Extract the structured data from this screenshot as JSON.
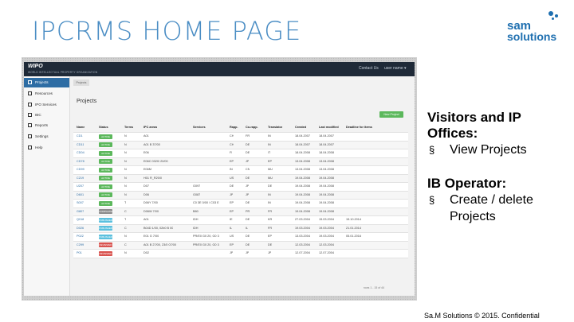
{
  "slide": {
    "title": "IPCRMS HOME PAGE",
    "logo_line1": "sam",
    "logo_line2": "solutions",
    "footer": "Sa.M Solutions © 2015. Confidential"
  },
  "app": {
    "brand": "WIPO",
    "brand_subtitle": "WORLD INTELLECTUAL PROPERTY ORGANIZATION",
    "top_right": [
      "Contact Us",
      "user name ▾"
    ],
    "breadcrumb": "Projects",
    "page_title": "Projects",
    "new_project_button": "New Project",
    "sidebar": [
      {
        "label": "Projects",
        "icon": "home-icon",
        "active": true
      },
      {
        "label": "Resources",
        "icon": "grid-icon",
        "active": false
      },
      {
        "label": "IPO Services",
        "icon": "list-icon",
        "active": false
      },
      {
        "label": "IBC",
        "icon": "building-icon",
        "active": false
      },
      {
        "label": "Reports",
        "icon": "report-icon",
        "active": false
      },
      {
        "label": "Settings",
        "icon": "gear-icon",
        "active": false
      },
      {
        "label": "Help",
        "icon": "help-icon",
        "active": false
      }
    ],
    "columns": [
      "Name",
      "Status",
      "Terms",
      "IPC areas",
      "Services",
      "Rapp.",
      "Co-rapp.",
      "Translator",
      "Created",
      "Last modified",
      "Deadline for items"
    ],
    "rows": [
      [
        "CD1",
        "ACTIVE",
        "N",
        "A01",
        "",
        "CH",
        "FR",
        "IN",
        "18.04.2007",
        "18.04.2007",
        ""
      ],
      [
        "CD11",
        "ACTIVE",
        "N",
        "A01 B 37/00",
        "",
        "CH",
        "DE",
        "IN",
        "18.04.2007",
        "18.04.2007",
        ""
      ],
      [
        "CD04",
        "ACTIVE",
        "N",
        "E06",
        "",
        "FI",
        "DE",
        "IT",
        "18.04.2008",
        "18.04.2008",
        ""
      ],
      [
        "CD78",
        "ACTIVE",
        "N",
        "E06C 0320/ 20/00",
        "",
        "EP",
        "JP",
        "EP",
        "13.04.2008",
        "13.04.2008",
        ""
      ],
      [
        "CD99",
        "ACTIVE",
        "N",
        "E06M",
        "",
        "IN",
        "CN",
        "MU",
        "13.04.2008",
        "13.04.2008",
        ""
      ],
      [
        "C219",
        "ACTIVE",
        "N",
        "H01 R_R20/0",
        "",
        "US",
        "DE",
        "MU",
        "19.04.2008",
        "19.04.2008",
        ""
      ],
      [
        "U207",
        "ACTIVE",
        "N",
        "D07",
        "G097",
        "DE",
        "JP",
        "DE",
        "19.04.2008",
        "19.04.2008",
        ""
      ],
      [
        "D601",
        "ACTIVE",
        "N",
        "D06",
        "G087",
        "JP",
        "JP",
        "IN",
        "19.04.2008",
        "19.04.2008",
        ""
      ],
      [
        "S007",
        "ACTIVE",
        "T",
        "D06Y 7/00",
        "C0 3E 0/00 / C03 E",
        "EP",
        "DE",
        "IN",
        "19.04.2008",
        "19.04.2008",
        ""
      ],
      [
        "G807",
        "COMPLETED",
        "C",
        "D06W 7/00",
        "B80",
        "EP",
        "PR",
        "FR",
        "19.04.2008",
        "19.04.2008",
        ""
      ],
      [
        "Q018",
        "PUBLISHED",
        "T",
        "A01",
        "IDH",
        "IE",
        "DE",
        "KR",
        "27.03.2004",
        "15.03.2004",
        "15.10.2014"
      ],
      [
        "D026",
        "PUBLISHED",
        "C",
        "B04D 1/00, 02b0 B 00",
        "IDH",
        "IL",
        "IL",
        "FR",
        "19.03.2004",
        "19.03.2004",
        "21.01.2014"
      ],
      [
        "P022",
        "PUBLISHED",
        "N",
        "E01 G 7/00",
        "PR/E0 G0 20, G0 3",
        "US",
        "DE",
        "EP",
        "13.03.2004",
        "19.03.2004",
        "05.01.2016"
      ],
      [
        "C299",
        "REVIEWED",
        "C",
        "A01 B 27/00, 23/0 07/00",
        "PR/E0 G0 20, G0 3",
        "EP",
        "DE",
        "DE",
        "12.03.2004",
        "12.03.2004",
        ""
      ],
      [
        "P01",
        "REVIEWED",
        "N",
        "D02",
        "",
        "JP",
        "JP",
        "JP",
        "12.07.2004",
        "12.07.2004",
        ""
      ]
    ],
    "pager": "rows 1 - 15 of 44"
  },
  "panel": {
    "heading1": "Visitors and IP Offices:",
    "bullets1": [
      "View Projects"
    ],
    "heading2": "IB Operator:",
    "bullets2": [
      "Create / delete Projects"
    ]
  },
  "colors": {
    "title": "#4a8dc4",
    "logo": "#1e6fb0",
    "topbar": "#1f2a38",
    "active": "#2e6da4",
    "status_active": "#5cb85c",
    "status_completed": "#8c8c8c",
    "status_published": "#5bc0de",
    "status_reviewed": "#d9534f"
  }
}
